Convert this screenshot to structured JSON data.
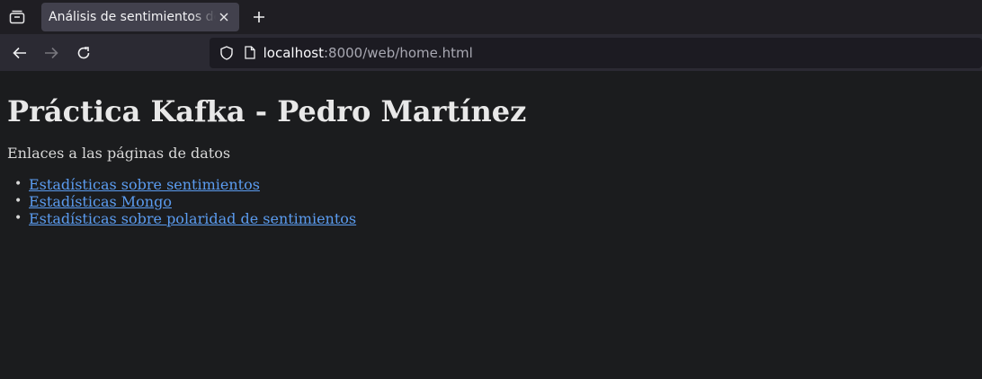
{
  "tab": {
    "title": "Análisis de sentimientos de TX"
  },
  "urlbar": {
    "host": "localhost",
    "rest": ":8000/web/home.html"
  },
  "page": {
    "heading": "Práctica Kafka - Pedro Martínez",
    "intro": "Enlaces a las páginas de datos",
    "links": [
      {
        "label": "Estadísticas sobre sentimientos"
      },
      {
        "label": "Estadísticas Mongo"
      },
      {
        "label": "Estadísticas sobre polaridad de sentimientos"
      }
    ]
  },
  "icons": {
    "tab_overview": "tab-overview-icon",
    "close": "close-icon",
    "new_tab": "plus-icon",
    "back": "back-arrow-icon",
    "forward": "forward-arrow-icon",
    "reload": "reload-icon",
    "shield": "shield-icon",
    "page": "page-icon"
  },
  "colors": {
    "link": "#5b9cf0",
    "background": "#1b1c1e"
  }
}
